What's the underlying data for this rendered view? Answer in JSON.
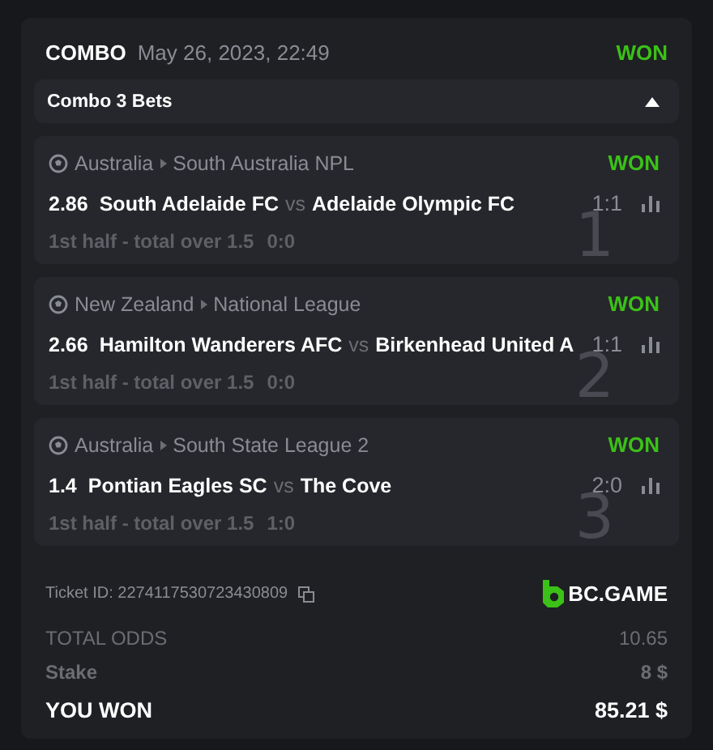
{
  "header": {
    "type": "COMBO",
    "date": "May 26, 2023, 22:49",
    "status": "WON"
  },
  "combo_bar": {
    "label": "Combo 3 Bets",
    "expanded": true
  },
  "bets": [
    {
      "country": "Australia",
      "league": "South Australia NPL",
      "status": "WON",
      "odds": "2.86",
      "home": "South Adelaide FC",
      "vs": "vs",
      "away": "Adelaide Olympic FC",
      "score": "1:1",
      "market": "1st half - total over 1.5",
      "market_score": "0:0",
      "index": "1"
    },
    {
      "country": "New Zealand",
      "league": "National League",
      "status": "WON",
      "odds": "2.66",
      "home": "Hamilton Wanderers AFC",
      "vs": "vs",
      "away": "Birkenhead United A",
      "score": "1:1",
      "market": "1st half - total over 1.5",
      "market_score": "0:0",
      "index": "2"
    },
    {
      "country": "Australia",
      "league": "South State League 2",
      "status": "WON",
      "odds": "1.4",
      "home": "Pontian Eagles SC",
      "vs": "vs",
      "away": "The Cove",
      "score": "2:0",
      "market": "1st half - total over 1.5",
      "market_score": "1:0",
      "index": "3"
    }
  ],
  "ticket": {
    "label": "Ticket ID: 2274117530723430809",
    "brand": "BC.GAME"
  },
  "totals": [
    {
      "kind": "muted",
      "label": "TOTAL ODDS",
      "value": "10.65"
    },
    {
      "kind": "bold",
      "label": "Stake",
      "value": "8 $"
    },
    {
      "kind": "highlight",
      "label": "YOU WON",
      "value": "85.21 $"
    }
  ]
}
